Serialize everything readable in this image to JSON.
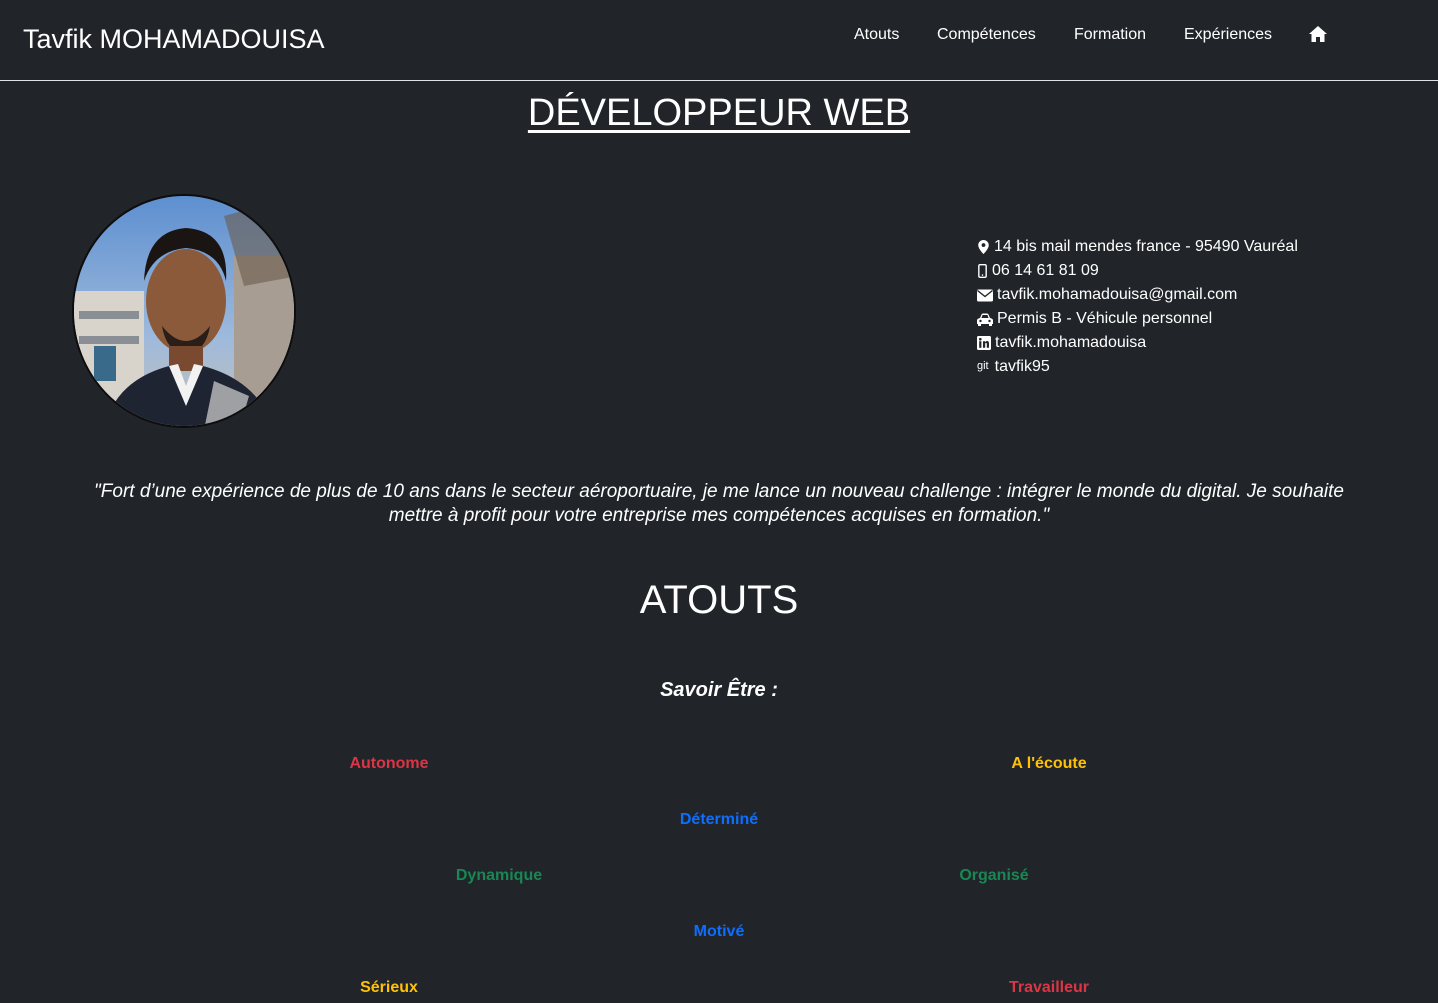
{
  "navbar": {
    "brand": "Tavfik MOHAMADOUISA",
    "links": [
      "Atouts",
      "Compétences",
      "Formation",
      "Expériences"
    ],
    "home_icon": "home-icon"
  },
  "headline": "DÉVELOPPEUR WEB",
  "contact": {
    "address": "14 bis mail mendes france - 95490 Vauréal",
    "phone": "06 14 61 81 09",
    "email": "tavfik.mohamadouisa@gmail.com",
    "license": "Permis B - Véhicule personnel",
    "linkedin": "tavfik.mohamadouisa",
    "git_label": "git",
    "git": "tavfik95"
  },
  "quote": "\"Fort d’une expérience de plus de 10 ans dans le secteur aéroportuaire, je me lance un nouveau challenge : intégrer le monde du digital. Je souhaite mettre à profit pour votre entreprise mes compétences acquises en formation.\"",
  "atouts": {
    "title": "ATOUTS",
    "subtitle": "Savoir Être :",
    "traits": [
      {
        "label": "Autonome",
        "color": "#dc3545"
      },
      {
        "label": "A l'écoute",
        "color": "#ffc107"
      },
      {
        "label": "Déterminé",
        "color": "#0d6efd"
      },
      {
        "label": "Dynamique",
        "color": "#198754"
      },
      {
        "label": "Organisé",
        "color": "#198754"
      },
      {
        "label": "Motivé",
        "color": "#0d6efd"
      },
      {
        "label": "Sérieux",
        "color": "#ffc107"
      },
      {
        "label": "Travailleur",
        "color": "#dc3545"
      }
    ]
  },
  "colors": {
    "background": "#212529",
    "text": "#ffffff",
    "border": "#dee2e6"
  }
}
